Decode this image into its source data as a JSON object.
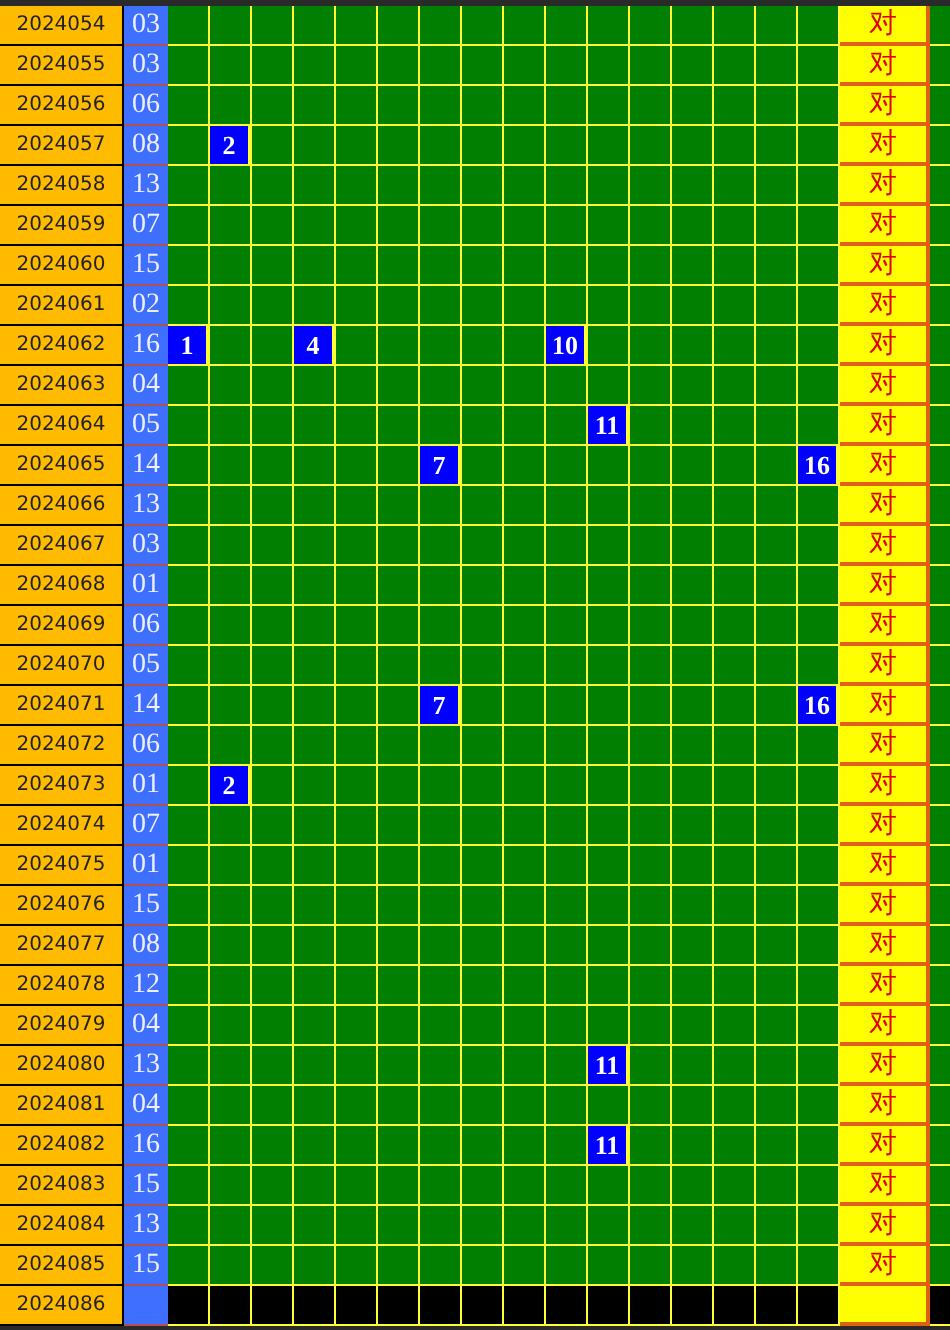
{
  "rows": [
    {
      "period": "2024054",
      "number": "03",
      "hits": [],
      "result": "对",
      "kind": "drawn"
    },
    {
      "period": "2024055",
      "number": "03",
      "hits": [],
      "result": "对",
      "kind": "drawn"
    },
    {
      "period": "2024056",
      "number": "06",
      "hits": [],
      "result": "对",
      "kind": "drawn"
    },
    {
      "period": "2024057",
      "number": "08",
      "hits": [
        "2"
      ],
      "result": "对",
      "kind": "drawn"
    },
    {
      "period": "2024058",
      "number": "13",
      "hits": [],
      "result": "对",
      "kind": "drawn"
    },
    {
      "period": "2024059",
      "number": "07",
      "hits": [],
      "result": "对",
      "kind": "drawn"
    },
    {
      "period": "2024060",
      "number": "15",
      "hits": [],
      "result": "对",
      "kind": "drawn"
    },
    {
      "period": "2024061",
      "number": "02",
      "hits": [],
      "result": "对",
      "kind": "drawn"
    },
    {
      "period": "2024062",
      "number": "16",
      "hits": [
        "1",
        "4",
        "10"
      ],
      "result": "对",
      "kind": "drawn"
    },
    {
      "period": "2024063",
      "number": "04",
      "hits": [],
      "result": "对",
      "kind": "drawn"
    },
    {
      "period": "2024064",
      "number": "05",
      "hits": [
        "11"
      ],
      "result": "对",
      "kind": "drawn"
    },
    {
      "period": "2024065",
      "number": "14",
      "hits": [
        "7",
        "16"
      ],
      "result": "对",
      "kind": "drawn"
    },
    {
      "period": "2024066",
      "number": "13",
      "hits": [],
      "result": "对",
      "kind": "drawn"
    },
    {
      "period": "2024067",
      "number": "03",
      "hits": [],
      "result": "对",
      "kind": "drawn"
    },
    {
      "period": "2024068",
      "number": "01",
      "hits": [],
      "result": "对",
      "kind": "drawn"
    },
    {
      "period": "2024069",
      "number": "06",
      "hits": [],
      "result": "对",
      "kind": "drawn"
    },
    {
      "period": "2024070",
      "number": "05",
      "hits": [],
      "result": "对",
      "kind": "drawn"
    },
    {
      "period": "2024071",
      "number": "14",
      "hits": [
        "7",
        "16"
      ],
      "result": "对",
      "kind": "drawn"
    },
    {
      "period": "2024072",
      "number": "06",
      "hits": [],
      "result": "对",
      "kind": "drawn"
    },
    {
      "period": "2024073",
      "number": "01",
      "hits": [
        "2"
      ],
      "result": "对",
      "kind": "drawn"
    },
    {
      "period": "2024074",
      "number": "07",
      "hits": [],
      "result": "对",
      "kind": "drawn"
    },
    {
      "period": "2024075",
      "number": "01",
      "hits": [],
      "result": "对",
      "kind": "drawn"
    },
    {
      "period": "2024076",
      "number": "15",
      "hits": [],
      "result": "对",
      "kind": "drawn"
    },
    {
      "period": "2024077",
      "number": "08",
      "hits": [],
      "result": "对",
      "kind": "drawn"
    },
    {
      "period": "2024078",
      "number": "12",
      "hits": [],
      "result": "对",
      "kind": "drawn"
    },
    {
      "period": "2024079",
      "number": "04",
      "hits": [],
      "result": "对",
      "kind": "drawn"
    },
    {
      "period": "2024080",
      "number": "13",
      "hits": [
        "11"
      ],
      "result": "对",
      "kind": "drawn"
    },
    {
      "period": "2024081",
      "number": "04",
      "hits": [],
      "result": "对",
      "kind": "drawn"
    },
    {
      "period": "2024082",
      "number": "16",
      "hits": [
        "11"
      ],
      "result": "对",
      "kind": "drawn"
    },
    {
      "period": "2024083",
      "number": "15",
      "hits": [],
      "result": "对",
      "kind": "drawn"
    },
    {
      "period": "2024084",
      "number": "13",
      "hits": [],
      "result": "对",
      "kind": "drawn"
    },
    {
      "period": "2024085",
      "number": "15",
      "hits": [],
      "result": "对",
      "kind": "drawn"
    },
    {
      "period": "2024086",
      "kind": "pending"
    }
  ]
}
